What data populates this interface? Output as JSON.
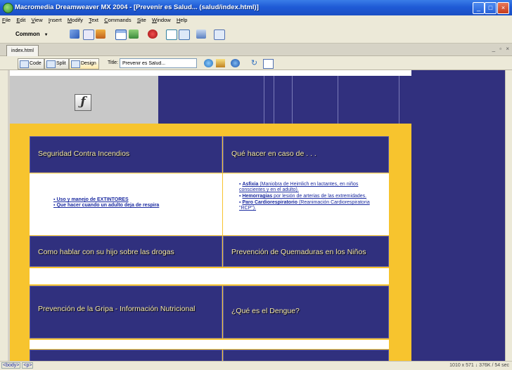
{
  "window": {
    "title": "Macromedia Dreamweaver MX 2004 - [Prevenir es Salud... (salud/index.html)]",
    "controls": [
      "_",
      "□",
      "×"
    ]
  },
  "menu": [
    "File",
    "Edit",
    "View",
    "Insert",
    "Modify",
    "Text",
    "Commands",
    "Site",
    "Window",
    "Help"
  ],
  "insert_bar": {
    "category": "Common",
    "icons": [
      "hyperlink-icon",
      "email-link-icon",
      "named-anchor-icon",
      "table-icon",
      "image-icon",
      "media-icon",
      "date-icon",
      "comment-icon",
      "template-icon",
      "tag-chooser-icon"
    ]
  },
  "document": {
    "tab": "index.html",
    "view_buttons": {
      "code": "Code",
      "split": "Split",
      "design": "Design"
    },
    "title_label": "Title:",
    "title_value": "Prevenir es Salud..."
  },
  "page": {
    "sections": [
      {
        "heading": "Seguridad Contra Incendios",
        "links": [
          "Uso y manejo de EXTINTORES",
          "Que hacer cuando un adulto deja de respira"
        ]
      },
      {
        "heading": "Qué hacer en caso de . . .",
        "items": [
          {
            "bold": "Asfixia",
            "rest": " (Maniobra de Heimlich en lactantes, en niños conscientes y en el adulto)."
          },
          {
            "bold": "Hemorragias",
            "rest": " por lesión de arterias de las extremidades."
          },
          {
            "bold": "Paro Cardiorespiratorio",
            "rest": " (Reanimación Cardiorespiratoria \"RCP\")."
          }
        ]
      },
      {
        "heading": "Como hablar con su hijo sobre las drogas"
      },
      {
        "heading": "Prevención de Quemaduras en  los Niños"
      },
      {
        "heading": "Prevención de la Gripa - Información Nutricional"
      },
      {
        "heading": "¿Qué es el Dengue?"
      }
    ]
  },
  "status_bar": {
    "tags": [
      "<body>",
      "<p>"
    ],
    "info": "1010 x 571 ↓ 376K / 54 sec"
  },
  "colors": {
    "navy": "#30307E",
    "gold": "#F7C42E",
    "heading_text": "#F5E9A8",
    "link": "#1A2AA0"
  }
}
